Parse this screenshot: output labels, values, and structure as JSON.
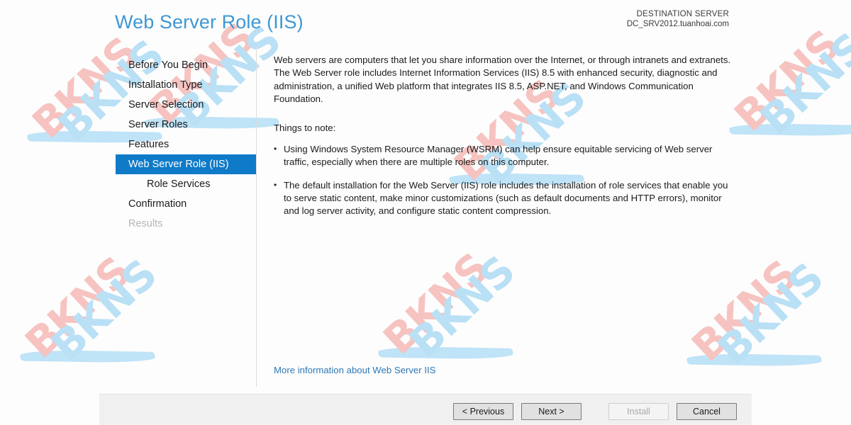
{
  "header": {
    "title": "Web Server Role (IIS)",
    "destination_label": "DESTINATION SERVER",
    "destination_server": "DC_SRV2012.tuanhoai.com"
  },
  "sidebar": {
    "items": [
      {
        "label": "Before You Begin",
        "state": "normal",
        "sub": false
      },
      {
        "label": "Installation Type",
        "state": "normal",
        "sub": false
      },
      {
        "label": "Server Selection",
        "state": "normal",
        "sub": false
      },
      {
        "label": "Server Roles",
        "state": "normal",
        "sub": false
      },
      {
        "label": "Features",
        "state": "normal",
        "sub": false
      },
      {
        "label": "Web Server Role (IIS)",
        "state": "active",
        "sub": false
      },
      {
        "label": "Role Services",
        "state": "normal",
        "sub": true
      },
      {
        "label": "Confirmation",
        "state": "normal",
        "sub": false
      },
      {
        "label": "Results",
        "state": "disabled",
        "sub": false
      }
    ]
  },
  "main": {
    "intro": "Web servers are computers that let you share information over the Internet, or through intranets and extranets. The Web Server role includes Internet Information Services (IIS) 8.5 with enhanced security, diagnostic and administration, a unified Web platform that integrates IIS 8.5, ASP.NET, and Windows Communication Foundation.",
    "things_to_note_label": "Things to note:",
    "bullets": [
      "Using Windows System Resource Manager (WSRM) can help ensure equitable servicing of Web server traffic, especially when there are multiple roles on this computer.",
      "The default installation for the Web Server (IIS) role includes the installation of role services that enable you to serve static content, make minor customizations (such as default documents and HTTP errors), monitor and log server activity, and configure static content compression."
    ],
    "more_info_link": "More information about Web Server IIS"
  },
  "footer": {
    "previous_label": "< Previous",
    "next_label": "Next >",
    "install_label": "Install",
    "install_enabled": false,
    "cancel_label": "Cancel"
  },
  "watermark": {
    "text": "BKNS",
    "pink_color": "#f6c3c0",
    "blue_color": "#b9e0f5"
  },
  "colors": {
    "accent_blue": "#0f7ac7",
    "title_blue": "#3f97d4",
    "link_blue": "#2f78b5"
  }
}
